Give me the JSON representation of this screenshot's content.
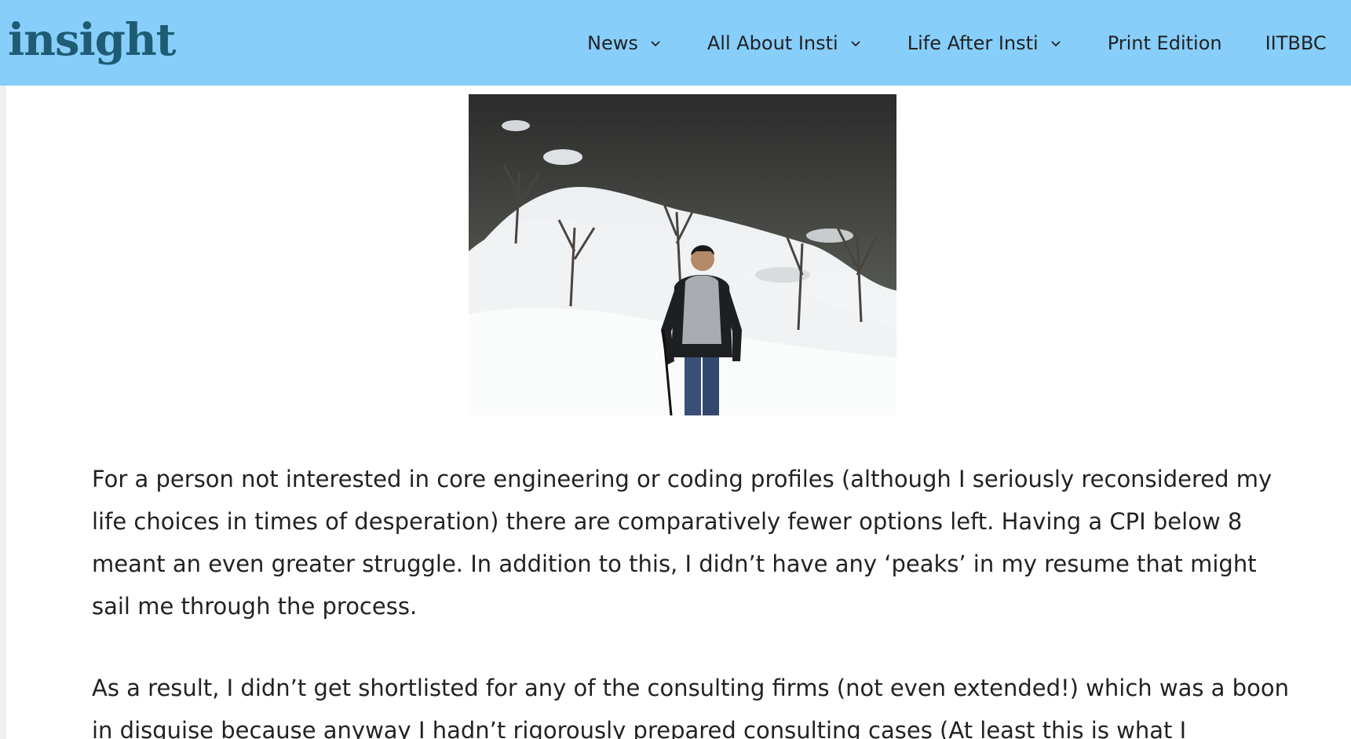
{
  "header": {
    "logo_text": "insight",
    "nav": [
      {
        "label": "News",
        "has_dropdown": true
      },
      {
        "label": "All About Insti",
        "has_dropdown": true
      },
      {
        "label": "Life After Insti",
        "has_dropdown": true
      },
      {
        "label": "Print Edition",
        "has_dropdown": false
      },
      {
        "label": "IITBBC",
        "has_dropdown": false
      }
    ]
  },
  "article": {
    "paragraphs": [
      "For a person not interested in core engineering or coding profiles (although I seriously reconsidered my life choices in times of desperation) there are comparatively fewer options left. Having a CPI below 8 meant an even greater struggle. In addition to this, I didn’t have any ‘peaks’ in my resume that might sail me through the process.",
      "As a result, I didn’t get shortlisted for any of the consulting firms (not even extended!) which was a boon in disguise because anyway I hadn’t rigorously prepared consulting cases (At least this is what I"
    ]
  },
  "colors": {
    "header_bg": "#87cefa",
    "logo": "#1e5c73",
    "text": "#222222",
    "page_bg": "#f0f0f0"
  }
}
